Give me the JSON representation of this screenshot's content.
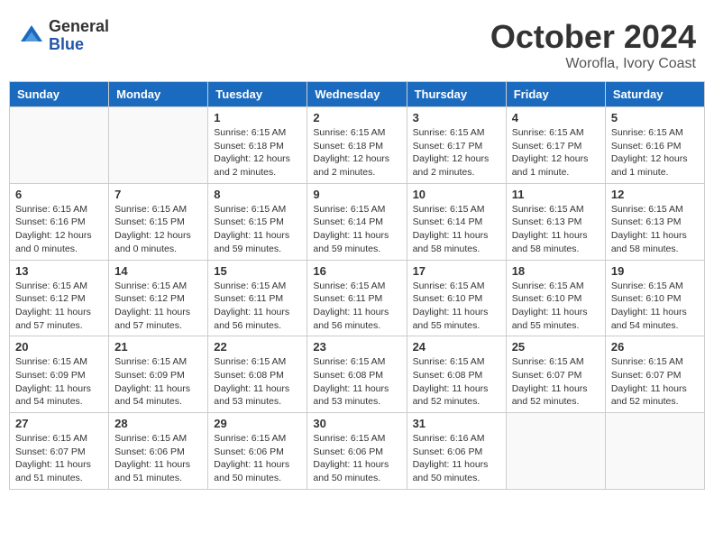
{
  "header": {
    "logo_general": "General",
    "logo_blue": "Blue",
    "month": "October 2024",
    "location": "Worofla, Ivory Coast"
  },
  "days_of_week": [
    "Sunday",
    "Monday",
    "Tuesday",
    "Wednesday",
    "Thursday",
    "Friday",
    "Saturday"
  ],
  "weeks": [
    [
      {
        "day": "",
        "info": ""
      },
      {
        "day": "",
        "info": ""
      },
      {
        "day": "1",
        "info": "Sunrise: 6:15 AM\nSunset: 6:18 PM\nDaylight: 12 hours\nand 2 minutes."
      },
      {
        "day": "2",
        "info": "Sunrise: 6:15 AM\nSunset: 6:18 PM\nDaylight: 12 hours\nand 2 minutes."
      },
      {
        "day": "3",
        "info": "Sunrise: 6:15 AM\nSunset: 6:17 PM\nDaylight: 12 hours\nand 2 minutes."
      },
      {
        "day": "4",
        "info": "Sunrise: 6:15 AM\nSunset: 6:17 PM\nDaylight: 12 hours\nand 1 minute."
      },
      {
        "day": "5",
        "info": "Sunrise: 6:15 AM\nSunset: 6:16 PM\nDaylight: 12 hours\nand 1 minute."
      }
    ],
    [
      {
        "day": "6",
        "info": "Sunrise: 6:15 AM\nSunset: 6:16 PM\nDaylight: 12 hours\nand 0 minutes."
      },
      {
        "day": "7",
        "info": "Sunrise: 6:15 AM\nSunset: 6:15 PM\nDaylight: 12 hours\nand 0 minutes."
      },
      {
        "day": "8",
        "info": "Sunrise: 6:15 AM\nSunset: 6:15 PM\nDaylight: 11 hours\nand 59 minutes."
      },
      {
        "day": "9",
        "info": "Sunrise: 6:15 AM\nSunset: 6:14 PM\nDaylight: 11 hours\nand 59 minutes."
      },
      {
        "day": "10",
        "info": "Sunrise: 6:15 AM\nSunset: 6:14 PM\nDaylight: 11 hours\nand 58 minutes."
      },
      {
        "day": "11",
        "info": "Sunrise: 6:15 AM\nSunset: 6:13 PM\nDaylight: 11 hours\nand 58 minutes."
      },
      {
        "day": "12",
        "info": "Sunrise: 6:15 AM\nSunset: 6:13 PM\nDaylight: 11 hours\nand 58 minutes."
      }
    ],
    [
      {
        "day": "13",
        "info": "Sunrise: 6:15 AM\nSunset: 6:12 PM\nDaylight: 11 hours\nand 57 minutes."
      },
      {
        "day": "14",
        "info": "Sunrise: 6:15 AM\nSunset: 6:12 PM\nDaylight: 11 hours\nand 57 minutes."
      },
      {
        "day": "15",
        "info": "Sunrise: 6:15 AM\nSunset: 6:11 PM\nDaylight: 11 hours\nand 56 minutes."
      },
      {
        "day": "16",
        "info": "Sunrise: 6:15 AM\nSunset: 6:11 PM\nDaylight: 11 hours\nand 56 minutes."
      },
      {
        "day": "17",
        "info": "Sunrise: 6:15 AM\nSunset: 6:10 PM\nDaylight: 11 hours\nand 55 minutes."
      },
      {
        "day": "18",
        "info": "Sunrise: 6:15 AM\nSunset: 6:10 PM\nDaylight: 11 hours\nand 55 minutes."
      },
      {
        "day": "19",
        "info": "Sunrise: 6:15 AM\nSunset: 6:10 PM\nDaylight: 11 hours\nand 54 minutes."
      }
    ],
    [
      {
        "day": "20",
        "info": "Sunrise: 6:15 AM\nSunset: 6:09 PM\nDaylight: 11 hours\nand 54 minutes."
      },
      {
        "day": "21",
        "info": "Sunrise: 6:15 AM\nSunset: 6:09 PM\nDaylight: 11 hours\nand 54 minutes."
      },
      {
        "day": "22",
        "info": "Sunrise: 6:15 AM\nSunset: 6:08 PM\nDaylight: 11 hours\nand 53 minutes."
      },
      {
        "day": "23",
        "info": "Sunrise: 6:15 AM\nSunset: 6:08 PM\nDaylight: 11 hours\nand 53 minutes."
      },
      {
        "day": "24",
        "info": "Sunrise: 6:15 AM\nSunset: 6:08 PM\nDaylight: 11 hours\nand 52 minutes."
      },
      {
        "day": "25",
        "info": "Sunrise: 6:15 AM\nSunset: 6:07 PM\nDaylight: 11 hours\nand 52 minutes."
      },
      {
        "day": "26",
        "info": "Sunrise: 6:15 AM\nSunset: 6:07 PM\nDaylight: 11 hours\nand 52 minutes."
      }
    ],
    [
      {
        "day": "27",
        "info": "Sunrise: 6:15 AM\nSunset: 6:07 PM\nDaylight: 11 hours\nand 51 minutes."
      },
      {
        "day": "28",
        "info": "Sunrise: 6:15 AM\nSunset: 6:06 PM\nDaylight: 11 hours\nand 51 minutes."
      },
      {
        "day": "29",
        "info": "Sunrise: 6:15 AM\nSunset: 6:06 PM\nDaylight: 11 hours\nand 50 minutes."
      },
      {
        "day": "30",
        "info": "Sunrise: 6:15 AM\nSunset: 6:06 PM\nDaylight: 11 hours\nand 50 minutes."
      },
      {
        "day": "31",
        "info": "Sunrise: 6:16 AM\nSunset: 6:06 PM\nDaylight: 11 hours\nand 50 minutes."
      },
      {
        "day": "",
        "info": ""
      },
      {
        "day": "",
        "info": ""
      }
    ]
  ]
}
